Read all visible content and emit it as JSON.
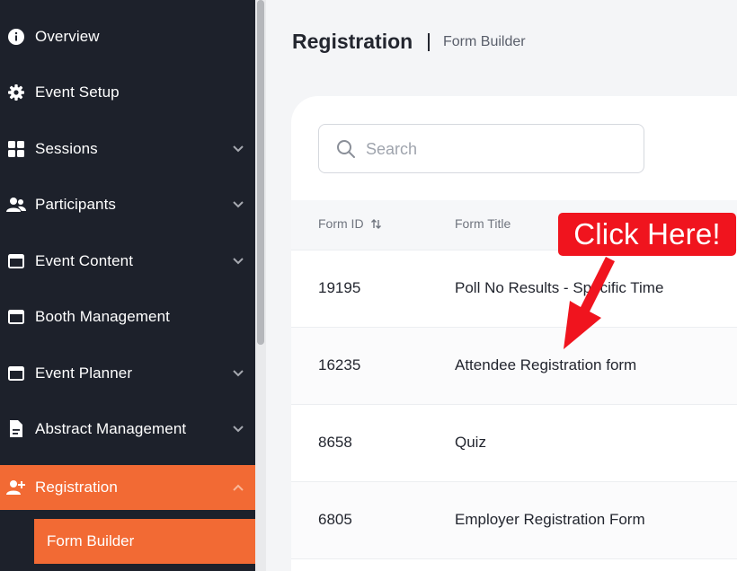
{
  "sidebar": {
    "items": [
      {
        "label": "Overview",
        "icon": "info-icon",
        "has_chevron": false
      },
      {
        "label": "Event Setup",
        "icon": "gear-icon",
        "has_chevron": false
      },
      {
        "label": "Sessions",
        "icon": "grid-icon",
        "has_chevron": true
      },
      {
        "label": "Participants",
        "icon": "users-icon",
        "has_chevron": true
      },
      {
        "label": "Event Content",
        "icon": "calendar-icon",
        "has_chevron": true
      },
      {
        "label": "Booth Management",
        "icon": "calendar-icon",
        "has_chevron": false
      },
      {
        "label": "Event Planner",
        "icon": "calendar-icon",
        "has_chevron": true
      },
      {
        "label": "Abstract Management",
        "icon": "document-icon",
        "has_chevron": true
      },
      {
        "label": "Registration",
        "icon": "user-plus-icon",
        "has_chevron": true,
        "active": true
      }
    ],
    "sub_item": "Form Builder",
    "accent": "#f26a34",
    "background": "#1d212b"
  },
  "header": {
    "title": "Registration",
    "breadcrumb": "Form Builder"
  },
  "search": {
    "placeholder": "Search"
  },
  "table": {
    "columns": [
      "Form ID",
      "Form Title"
    ],
    "rows": [
      {
        "id": "19195",
        "title": "Poll No Results - Specific Time"
      },
      {
        "id": "16235",
        "title": "Attendee Registration form"
      },
      {
        "id": "8658",
        "title": "Quiz"
      },
      {
        "id": "6805",
        "title": "Employer Registration Form"
      }
    ]
  },
  "callout": {
    "text": "Click Here!",
    "color": "#f0141e"
  }
}
